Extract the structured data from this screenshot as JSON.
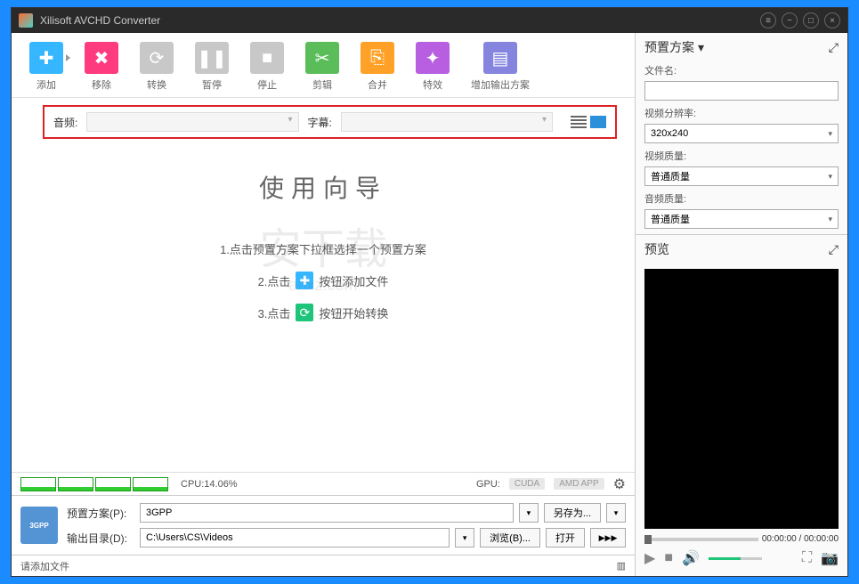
{
  "window": {
    "title": "Xilisoft AVCHD Converter"
  },
  "toolbar": {
    "add": "添加",
    "remove": "移除",
    "convert": "转换",
    "pause": "暂停",
    "stop": "停止",
    "cut": "剪辑",
    "merge": "合并",
    "effect": "特效",
    "profile": "增加输出方案"
  },
  "filter": {
    "audio": "音频:",
    "subtitle": "字幕:"
  },
  "wizard": {
    "title": "使用向导",
    "step1": "1.点击预置方案下拉框选择一个预置方案",
    "step2_pre": "2.点击",
    "step2_post": "按钮添加文件",
    "step3_pre": "3.点击",
    "step3_post": "按钮开始转换"
  },
  "watermark": {
    "main": "安下载",
    "sub": "anxz.com"
  },
  "cpu": {
    "label": "CPU:14.06%",
    "gpu": "GPU:",
    "cuda": "CUDA",
    "amd": "AMD APP"
  },
  "bottom": {
    "profile_label": "预置方案(P):",
    "profile_value": "3GPP",
    "saveas": "另存为...",
    "output_label": "输出目录(D):",
    "output_value": "C:\\Users\\CS\\Videos",
    "browse": "浏览(B)...",
    "open": "打开"
  },
  "status": {
    "text": "请添加文件"
  },
  "right": {
    "preset_title": "预置方案",
    "filename": "文件名:",
    "resolution_label": "视频分辨率:",
    "resolution_value": "320x240",
    "vquality_label": "视频质量:",
    "vquality_value": "普通质量",
    "aquality_label": "音频质量:",
    "aquality_value": "普通质量",
    "preview_title": "预览",
    "time": "00:00:00 / 00:00:00"
  }
}
